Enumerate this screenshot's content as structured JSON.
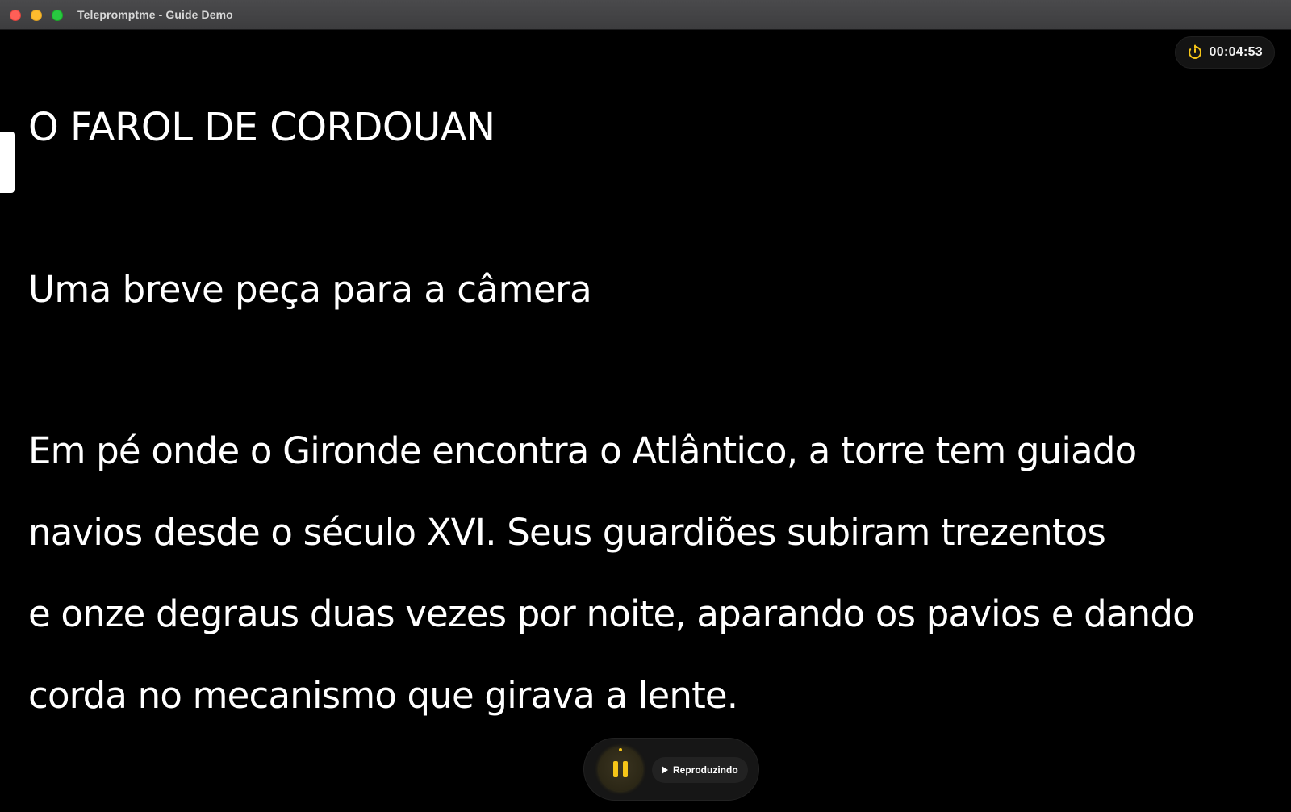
{
  "window": {
    "title": "Telepromptme - Guide Demo"
  },
  "timer": {
    "icon": "timer-icon",
    "value": "00:04:53",
    "accent_color": "#f5c518"
  },
  "script": {
    "title": "O FAROL DE CORDOUAN",
    "subtitle": "Uma breve peça para a câmera",
    "body_lines": [
      "Em pé onde o Gironde encontra o Atlântico, a torre tem guiado",
      "navios desde o século XVI. Seus guardiões subiram trezentos",
      "e onze degraus duas vezes por noite, aparando os pavios e dando",
      "corda no mecanismo que girava a lente."
    ]
  },
  "controls": {
    "pause_icon": "pause-icon",
    "status_icon": "play-icon",
    "status_label": "Reproduzindo",
    "accent_color": "#f5c518"
  }
}
